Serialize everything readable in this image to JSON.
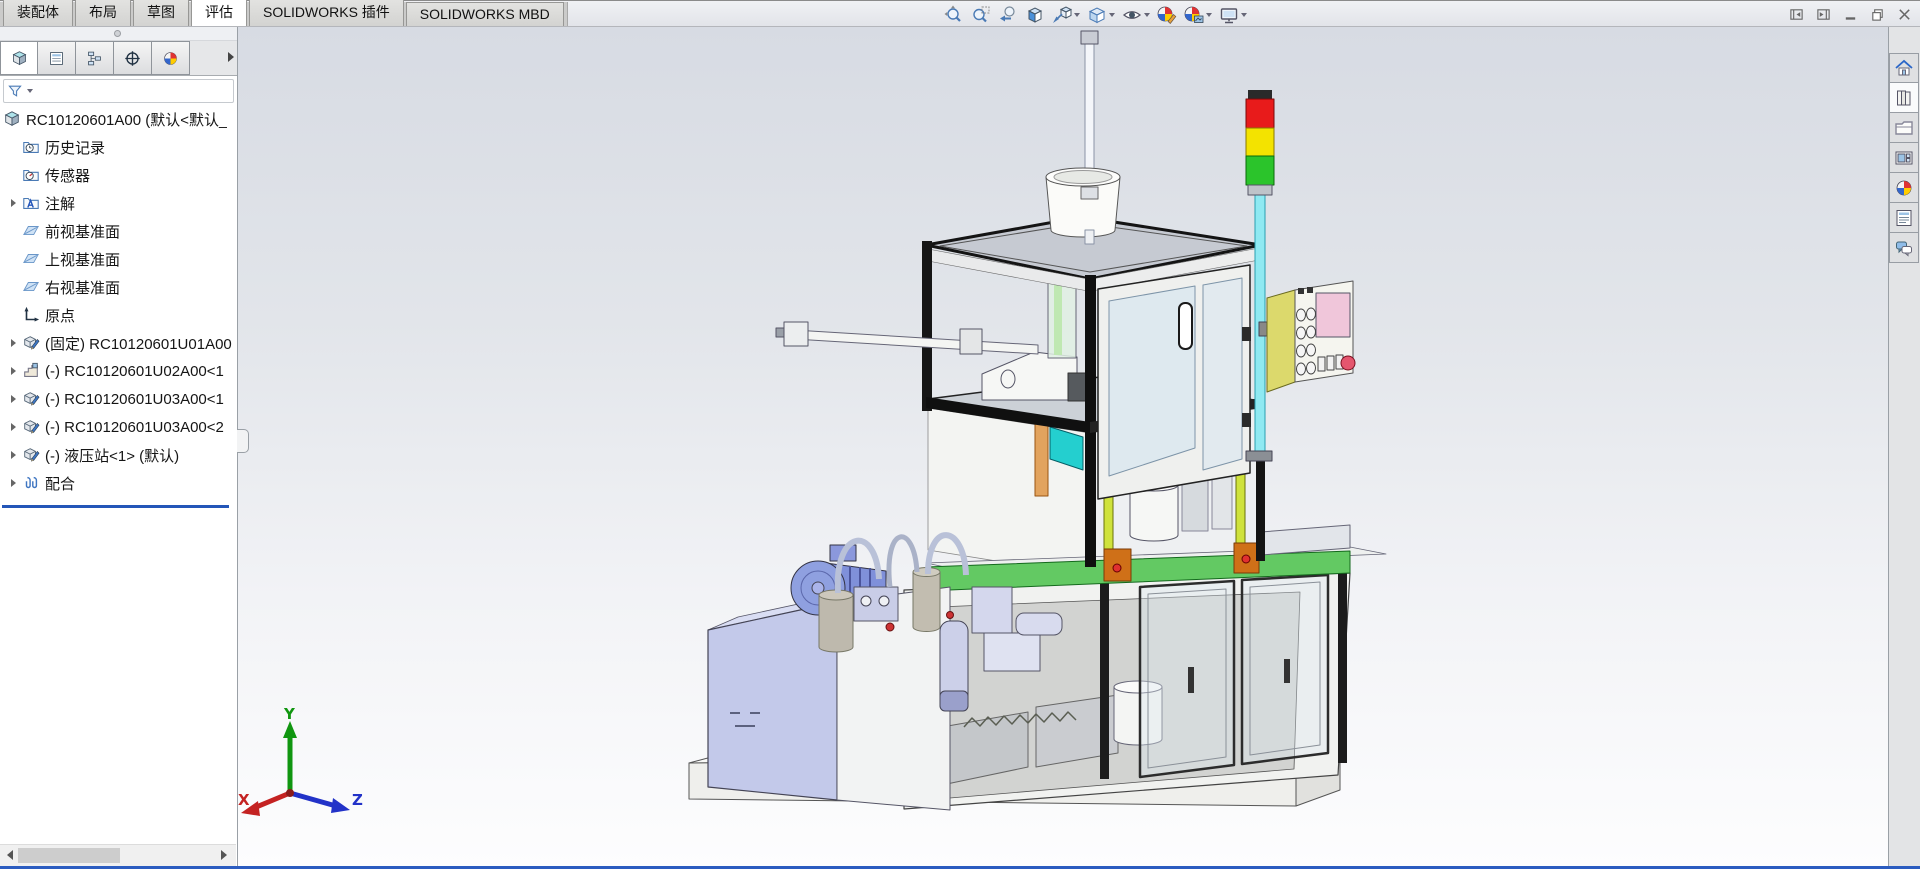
{
  "titlebar": {
    "menu_tabs": [
      {
        "label": "装配体",
        "active": false
      },
      {
        "label": "布局",
        "active": false
      },
      {
        "label": "草图",
        "active": false
      },
      {
        "label": "评估",
        "active": true
      },
      {
        "label": "SOLIDWORKS 插件",
        "active": false
      },
      {
        "label": "SOLIDWORKS MBD",
        "active": false
      }
    ],
    "tools": [
      {
        "name": "zoom-to-fit",
        "dropdown": false
      },
      {
        "name": "zoom-to-area",
        "dropdown": false
      },
      {
        "name": "previous-view",
        "dropdown": false
      },
      {
        "name": "section-view",
        "dropdown": false
      },
      {
        "name": "view-orientation",
        "dropdown": true
      },
      {
        "name": "display-style",
        "dropdown": true
      },
      {
        "name": "hide-show-items",
        "dropdown": true
      },
      {
        "name": "edit-appearance",
        "dropdown": false
      },
      {
        "name": "apply-scene",
        "dropdown": true
      },
      {
        "name": "view-settings",
        "dropdown": true
      }
    ],
    "window_controls": [
      "collapse-pane-left",
      "collapse-pane-right",
      "minimize",
      "restore",
      "close"
    ]
  },
  "feature_panel": {
    "tabs": [
      {
        "name": "featuremanager-design-tree",
        "active": true
      },
      {
        "name": "propertymanager",
        "active": false
      },
      {
        "name": "configurationmanager",
        "active": false
      },
      {
        "name": "dimxpertmanager",
        "active": false
      },
      {
        "name": "displaymanager",
        "active": false
      }
    ],
    "filter_icon": "filter-funnel",
    "tree": {
      "root": {
        "label": "RC10120601A00 (默认<默认_",
        "icon": "assembly"
      },
      "items": [
        {
          "label": "历史记录",
          "icon": "history-folder",
          "expandable": false
        },
        {
          "label": "传感器",
          "icon": "sensors-folder",
          "expandable": false
        },
        {
          "label": "注解",
          "icon": "annotations-folder",
          "expandable": true
        },
        {
          "label": "前视基准面",
          "icon": "reference-plane",
          "expandable": false
        },
        {
          "label": "上视基准面",
          "icon": "reference-plane",
          "expandable": false
        },
        {
          "label": "右视基准面",
          "icon": "reference-plane",
          "expandable": false
        },
        {
          "label": "原点",
          "icon": "origin",
          "expandable": false
        },
        {
          "label": "(固定) RC10120601U01A00",
          "icon": "subassembly",
          "expandable": true
        },
        {
          "label": "(-) RC10120601U02A00<1",
          "icon": "part",
          "expandable": true
        },
        {
          "label": "(-) RC10120601U03A00<1",
          "icon": "subassembly",
          "expandable": true
        },
        {
          "label": "(-) RC10120601U03A00<2",
          "icon": "subassembly",
          "expandable": true
        },
        {
          "label": "(-) 液压站<1> (默认)",
          "icon": "subassembly",
          "expandable": true
        },
        {
          "label": "配合",
          "icon": "mates",
          "expandable": true
        }
      ]
    }
  },
  "task_pane": {
    "items": [
      {
        "name": "home",
        "active": false
      },
      {
        "name": "design-library",
        "active": true
      },
      {
        "name": "file-explorer",
        "active": false
      },
      {
        "name": "view-palette",
        "active": false
      },
      {
        "name": "appearances-scenes",
        "active": false
      },
      {
        "name": "custom-properties",
        "active": false
      },
      {
        "name": "solidworks-forum",
        "active": false
      }
    ]
  },
  "viewport": {
    "triad": {
      "x_label": "X",
      "y_label": "Y",
      "z_label": "Z",
      "x_color": "#c42222",
      "y_color": "#109610",
      "z_color": "#2232c8"
    },
    "machine": {
      "colors": {
        "signal_red": "#e81b1b",
        "signal_yellow": "#f3e300",
        "signal_green": "#2bc42b",
        "signal_pole": "#8fe9f2",
        "deck_green": "#63c963",
        "clamp_orange": "#cf7018",
        "pendant_body": "#dcd96c",
        "pendant_screen": "#f0c6da",
        "pendant_stop": "#e4566e",
        "tank": "#c3c9ea",
        "motor": "#7f90da",
        "chute_teal": "#24cfcf",
        "light_curtain": "#cfe23c",
        "cylinder_green": "#bfe8b2",
        "frame": "#161616",
        "orange_strip": "#e2a35e"
      }
    }
  }
}
